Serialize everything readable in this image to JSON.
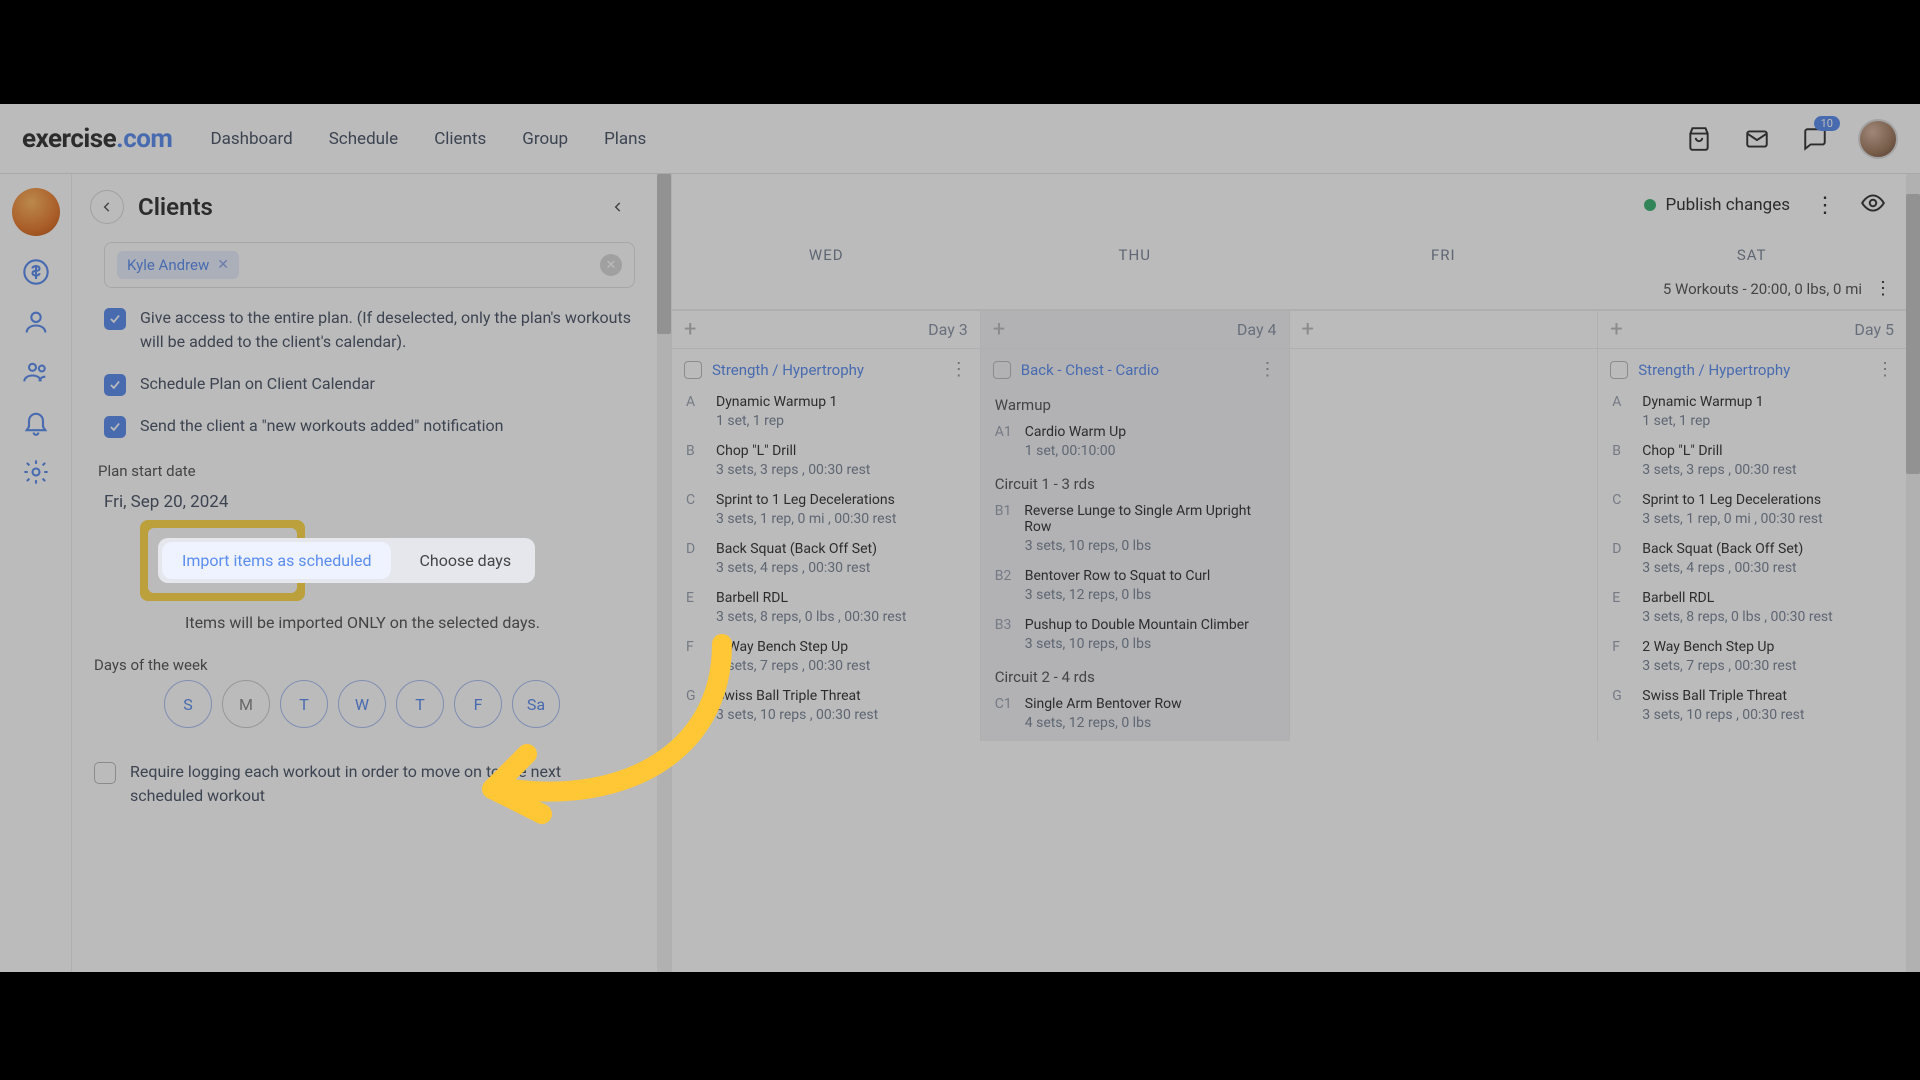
{
  "brand": {
    "part1": "exercise",
    "part2": ".com"
  },
  "nav": {
    "dashboard": "Dashboard",
    "schedule": "Schedule",
    "clients": "Clients",
    "group": "Group",
    "plans": "Plans"
  },
  "notif_count": "10",
  "panel": {
    "title": "Clients",
    "client_chip": "Kyle Andrew",
    "opt_access": "Give access to the entire plan. (If deselected, only the plan's workouts will be added to the client's calendar).",
    "opt_schedule": "Schedule Plan on Client Calendar",
    "opt_notify": "Send the client a \"new workouts added\" notification",
    "start_label": "Plan start date",
    "start_date": "Fri, Sep 20, 2024",
    "tab_import": "Import items as scheduled",
    "tab_choose": "Choose days",
    "hint": "Items will be imported ONLY on the selected days.",
    "days_label": "Days of the week",
    "days": [
      "S",
      "M",
      "T",
      "W",
      "T",
      "F",
      "Sa"
    ],
    "opt_require": "Require logging each workout in order to move on to the next scheduled workout"
  },
  "content": {
    "publish": "Publish changes",
    "day_headers": [
      "WED",
      "THU",
      "FRI",
      "SAT"
    ],
    "week_summary": "5 Workouts - 20:00, 0 lbs, 0 mi",
    "cols": [
      {
        "day_label": "Day 3",
        "workout_title": "Strength / Hypertrophy",
        "items": [
          {
            "idx": "A",
            "name": "Dynamic Warmup 1",
            "detail": "1 set, 1 rep"
          },
          {
            "idx": "B",
            "name": "Chop \"L\" Drill",
            "detail": "3 sets, 3 reps , 00:30 rest"
          },
          {
            "idx": "C",
            "name": "Sprint to 1 Leg Decelerations",
            "detail": "3 sets, 1 rep, 0 mi , 00:30 rest"
          },
          {
            "idx": "D",
            "name": "Back Squat (Back Off Set)",
            "detail": "3 sets, 4 reps , 00:30 rest"
          },
          {
            "idx": "E",
            "name": "Barbell RDL",
            "detail": "3 sets, 8 reps, 0 lbs , 00:30 rest"
          },
          {
            "idx": "F",
            "name": "2 Way Bench Step Up",
            "detail": "3 sets, 7 reps , 00:30 rest"
          },
          {
            "idx": "G",
            "name": "Swiss Ball Triple Threat",
            "detail": "3 sets, 10 reps , 00:30 rest"
          }
        ]
      },
      {
        "day_label": "Day 4",
        "workout_title": "Back - Chest - Cardio",
        "groups": [
          {
            "label": "Warmup",
            "items": [
              {
                "idx": "A1",
                "name": "Cardio Warm Up",
                "detail": "1 set, 00:10:00"
              }
            ]
          },
          {
            "label": "Circuit 1 - 3 rds",
            "items": [
              {
                "idx": "B1",
                "name": "Reverse Lunge to Single Arm Upright Row",
                "detail": "3 sets, 10 reps, 0 lbs"
              },
              {
                "idx": "B2",
                "name": "Bentover Row to Squat to Curl",
                "detail": "3 sets, 12 reps, 0 lbs"
              },
              {
                "idx": "B3",
                "name": "Pushup to Double Mountain Climber",
                "detail": "3 sets, 10 reps, 0 lbs"
              }
            ]
          },
          {
            "label": "Circuit 2 - 4 rds",
            "items": [
              {
                "idx": "C1",
                "name": "Single Arm Bentover Row",
                "detail": "4 sets, 12 reps, 0 lbs"
              }
            ]
          }
        ]
      },
      {
        "day_label": "",
        "workout_title": "",
        "items": []
      },
      {
        "day_label": "Day 5",
        "workout_title": "Strength / Hypertrophy",
        "items": [
          {
            "idx": "A",
            "name": "Dynamic Warmup 1",
            "detail": "1 set, 1 rep"
          },
          {
            "idx": "B",
            "name": "Chop \"L\" Drill",
            "detail": "3 sets, 3 reps , 00:30 rest"
          },
          {
            "idx": "C",
            "name": "Sprint to 1 Leg Decelerations",
            "detail": "3 sets, 1 rep, 0 mi , 00:30 rest"
          },
          {
            "idx": "D",
            "name": "Back Squat (Back Off Set)",
            "detail": "3 sets, 4 reps , 00:30 rest"
          },
          {
            "idx": "E",
            "name": "Barbell RDL",
            "detail": "3 sets, 8 reps, 0 lbs , 00:30 rest"
          },
          {
            "idx": "F",
            "name": "2 Way Bench Step Up",
            "detail": "3 sets, 7 reps , 00:30 rest"
          },
          {
            "idx": "G",
            "name": "Swiss Ball Triple Threat",
            "detail": "3 sets, 10 reps , 00:30 rest"
          }
        ]
      }
    ]
  }
}
